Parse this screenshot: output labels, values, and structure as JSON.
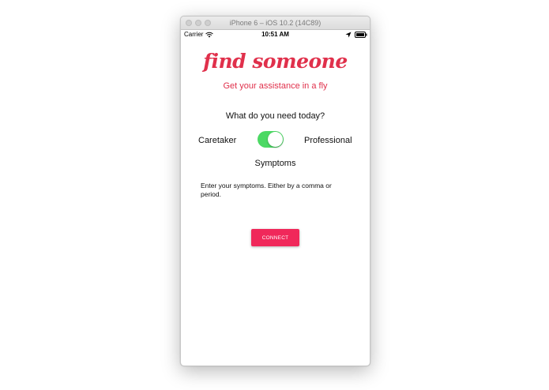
{
  "window": {
    "title": "iPhone 6 – iOS 10.2 (14C89)"
  },
  "status_bar": {
    "carrier": "Carrier",
    "time": "10:51 AM",
    "icons": [
      "wifi-icon",
      "location-icon",
      "battery-icon"
    ]
  },
  "header": {
    "title": "find someone",
    "subtitle": "Get your assistance in a fly"
  },
  "form": {
    "question": "What do you need today?",
    "toggle": {
      "left_label": "Caretaker",
      "right_label": "Professional",
      "on": true
    },
    "symptoms_label": "Symptoms",
    "symptoms_placeholder": "Enter your symptoms. Either by a comma or period.",
    "connect_label": "CONNECT"
  },
  "colors": {
    "brand": "#e0304b",
    "button": "#f0285a",
    "toggle_on": "#4cd964"
  }
}
